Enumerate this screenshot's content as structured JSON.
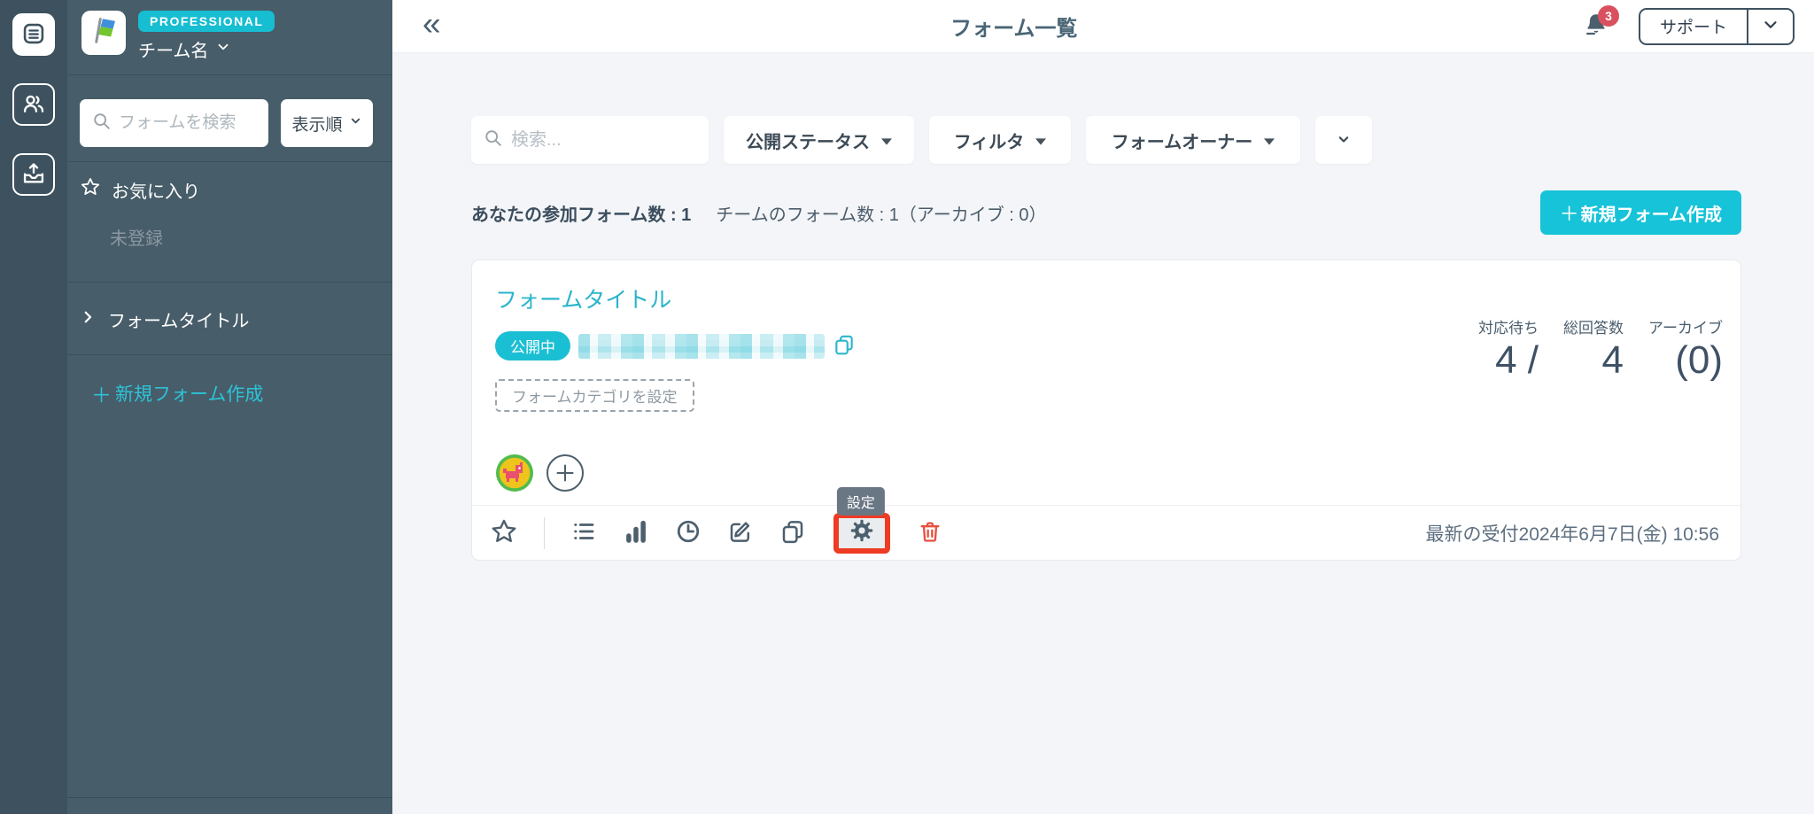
{
  "sidebar": {
    "plan_badge": "PROFESSIONAL",
    "team_name": "チーム名",
    "search_placeholder": "フォームを検索",
    "sort_label": "表示順",
    "favorites_label": "お気に入り",
    "favorites_empty": "未登録",
    "form_group_label": "フォームタイトル",
    "new_form_plus": "＋",
    "new_form_label": "新規フォーム作成"
  },
  "header": {
    "collapse_icon": "«",
    "title": "フォーム一覧",
    "notification_count": "3",
    "support_label": "サポート"
  },
  "filters": {
    "search_placeholder": "検索...",
    "dropdowns": [
      {
        "label": "公開ステータス"
      },
      {
        "label": "フィルタ"
      },
      {
        "label": "フォームオーナー"
      }
    ]
  },
  "summary": {
    "my_forms": "あなたの参加フォーム数 : 1",
    "team_forms": "チームのフォーム数 : 1（アーカイブ : 0）",
    "new_form_plus": "＋",
    "new_form_label": "新規フォーム作成"
  },
  "card": {
    "title": "フォームタイトル",
    "status_badge": "公開中",
    "category_button": "フォームカテゴリを設定",
    "metrics": [
      {
        "label": "対応待ち",
        "value": "4 /"
      },
      {
        "label": "総回答数",
        "value": "4"
      },
      {
        "label": "アーカイブ",
        "value": "(0)"
      }
    ],
    "settings_tooltip": "設定",
    "latest_reception": "最新の受付2024年6月7日(金) 10:56"
  },
  "colors": {
    "accent_teal": "#17c0d4",
    "highlight_red": "#ee3b23",
    "danger_red": "#e8503e",
    "notification_red": "#d9515e",
    "sidebar_bg": "#475d69",
    "rail_bg": "#3d525e",
    "text_slate": "#4a5d6d"
  }
}
